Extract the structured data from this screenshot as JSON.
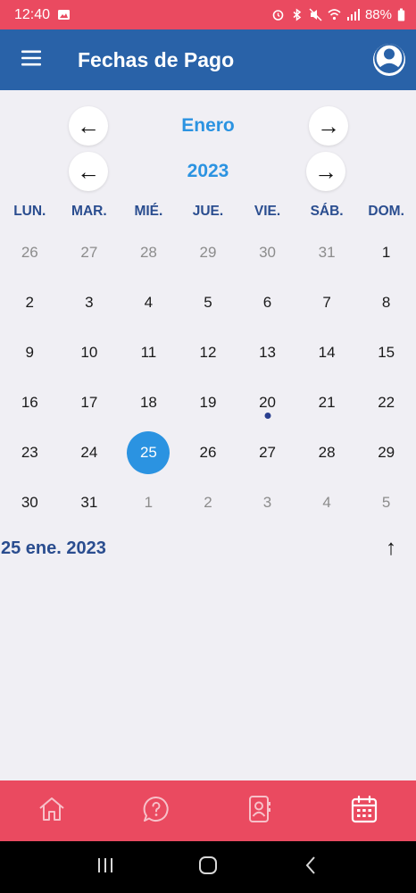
{
  "status_bar": {
    "time": "12:40",
    "battery": "88%",
    "icons": [
      "gallery-icon",
      "alarm-icon",
      "bluetooth-icon",
      "mute-icon",
      "wifi-icon",
      "signal-icon",
      "battery-icon"
    ]
  },
  "app_bar": {
    "title": "Fechas de Pago",
    "menu_icon": "menu-icon",
    "profile_icon": "account-circle-icon"
  },
  "month_nav": {
    "label": "Enero",
    "prev_symbol": "←",
    "next_symbol": "→"
  },
  "year_nav": {
    "label": "2023",
    "prev_symbol": "←",
    "next_symbol": "→"
  },
  "weekdays": [
    "LUN.",
    "MAR.",
    "MIÉ.",
    "JUE.",
    "VIE.",
    "SÁB.",
    "DOM."
  ],
  "days": [
    {
      "label": "26",
      "in_month": false
    },
    {
      "label": "27",
      "in_month": false
    },
    {
      "label": "28",
      "in_month": false
    },
    {
      "label": "29",
      "in_month": false
    },
    {
      "label": "30",
      "in_month": false
    },
    {
      "label": "31",
      "in_month": false
    },
    {
      "label": "1",
      "in_month": true
    },
    {
      "label": "2",
      "in_month": true
    },
    {
      "label": "3",
      "in_month": true
    },
    {
      "label": "4",
      "in_month": true
    },
    {
      "label": "5",
      "in_month": true
    },
    {
      "label": "6",
      "in_month": true
    },
    {
      "label": "7",
      "in_month": true
    },
    {
      "label": "8",
      "in_month": true
    },
    {
      "label": "9",
      "in_month": true
    },
    {
      "label": "10",
      "in_month": true
    },
    {
      "label": "11",
      "in_month": true
    },
    {
      "label": "12",
      "in_month": true
    },
    {
      "label": "13",
      "in_month": true
    },
    {
      "label": "14",
      "in_month": true
    },
    {
      "label": "15",
      "in_month": true
    },
    {
      "label": "16",
      "in_month": true
    },
    {
      "label": "17",
      "in_month": true
    },
    {
      "label": "18",
      "in_month": true
    },
    {
      "label": "19",
      "in_month": true
    },
    {
      "label": "20",
      "in_month": true,
      "has_event": true
    },
    {
      "label": "21",
      "in_month": true
    },
    {
      "label": "22",
      "in_month": true
    },
    {
      "label": "23",
      "in_month": true
    },
    {
      "label": "24",
      "in_month": true
    },
    {
      "label": "25",
      "in_month": true,
      "selected": true
    },
    {
      "label": "26",
      "in_month": true
    },
    {
      "label": "27",
      "in_month": true
    },
    {
      "label": "28",
      "in_month": true
    },
    {
      "label": "29",
      "in_month": true
    },
    {
      "label": "30",
      "in_month": true
    },
    {
      "label": "31",
      "in_month": true
    },
    {
      "label": "1",
      "in_month": false
    },
    {
      "label": "2",
      "in_month": false
    },
    {
      "label": "3",
      "in_month": false
    },
    {
      "label": "4",
      "in_month": false
    },
    {
      "label": "5",
      "in_month": false
    }
  ],
  "selected_date": {
    "label": "25 ene. 2023",
    "collapse_symbol": "↑"
  },
  "bottom_nav": [
    {
      "name": "nav-home",
      "icon": "home-icon"
    },
    {
      "name": "nav-help",
      "icon": "help-chat-icon"
    },
    {
      "name": "nav-contacts",
      "icon": "contacts-book-icon"
    },
    {
      "name": "nav-calendar",
      "icon": "calendar-icon",
      "active": true
    }
  ],
  "system_nav": [
    {
      "name": "recent-apps-button",
      "icon": "recents-icon"
    },
    {
      "name": "home-button",
      "icon": "home-pill-icon"
    },
    {
      "name": "back-button",
      "icon": "back-chevron-icon"
    }
  ],
  "colors": {
    "status_bar_bg": "#ea4a60",
    "app_bar_bg": "#2962a8",
    "accent_blue": "#2b93e1",
    "weekday_text": "#2a4d8f",
    "background": "#f0eff4",
    "event_dot": "#2a3f8f",
    "bottom_nav_bg": "#ea4a60"
  }
}
